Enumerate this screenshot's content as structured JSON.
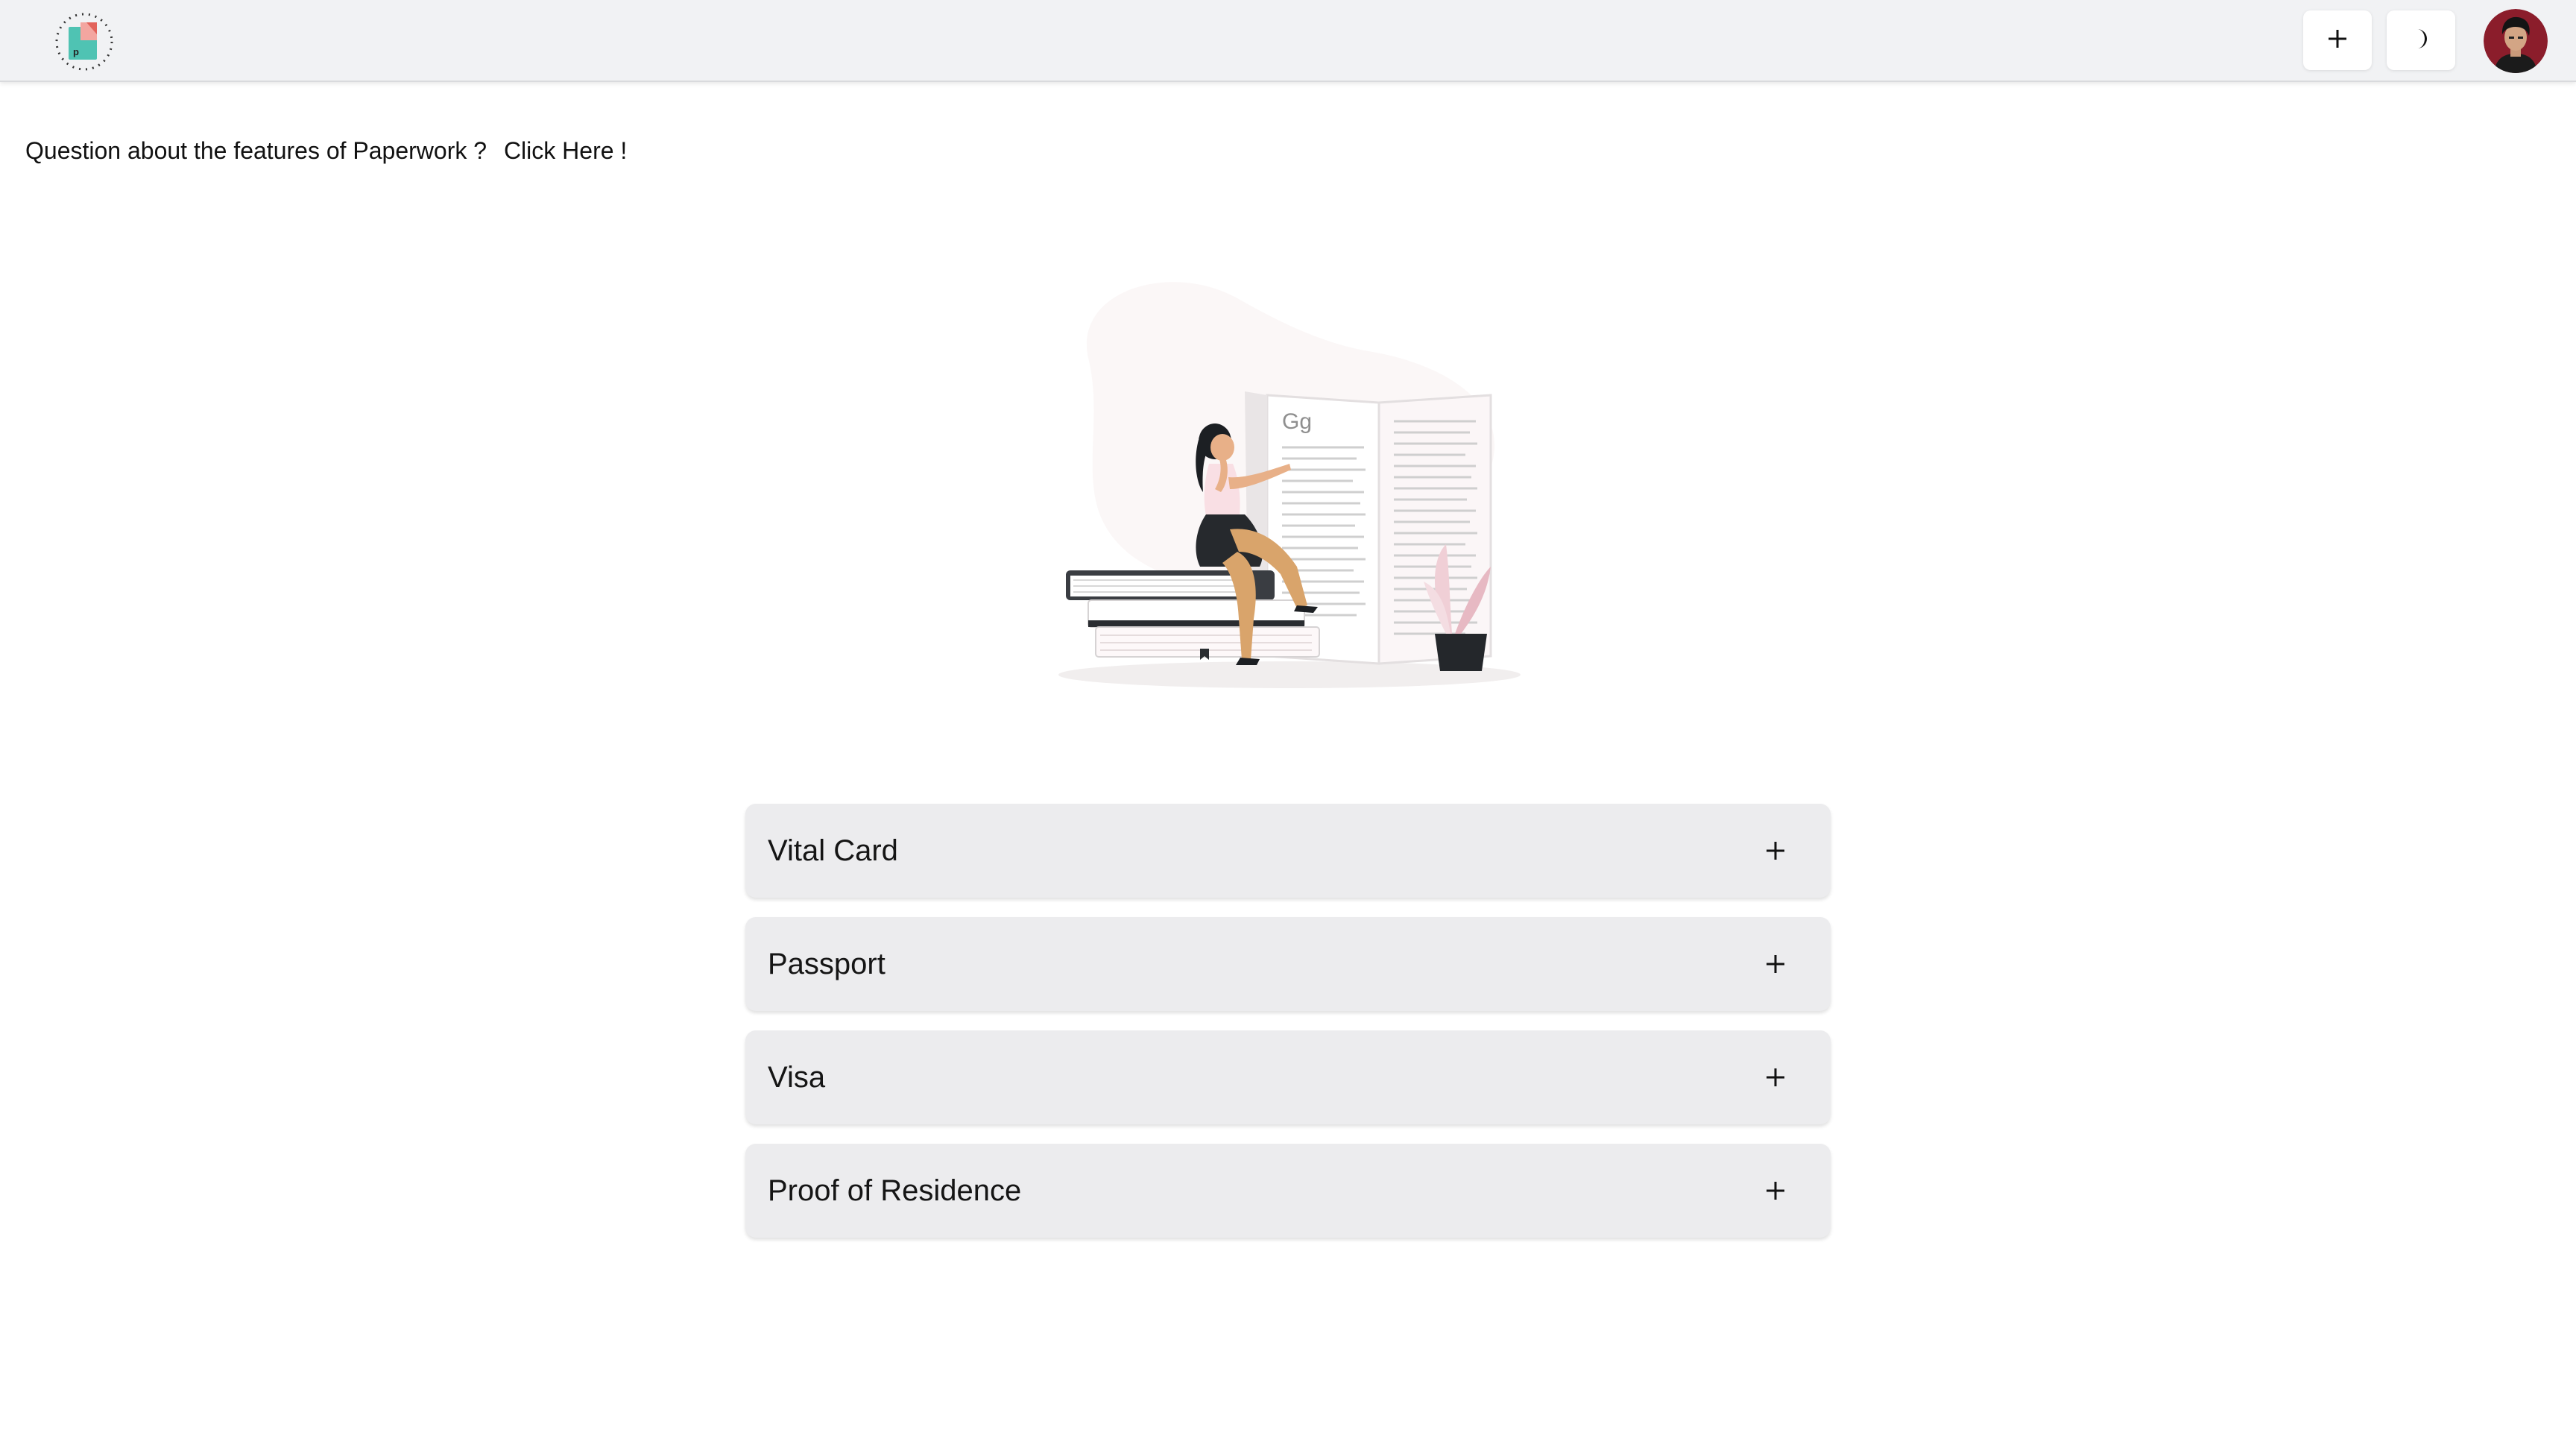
{
  "header": {
    "logo_icon": "paperwork-logo-icon",
    "add_icon": "plus-icon",
    "theme_icon": "moon-icon",
    "avatar_icon": "user-avatar"
  },
  "help": {
    "question": "Question about the features of Paperwork ?",
    "link": "Click Here !"
  },
  "illustration": {
    "icon": "woman-reading-books-illustration",
    "book_text": "Gg"
  },
  "documents": {
    "items": [
      {
        "label": "Vital Card"
      },
      {
        "label": "Passport"
      },
      {
        "label": "Visa"
      },
      {
        "label": "Proof of Residence"
      }
    ]
  },
  "colors": {
    "topbar": "#f1f2f4",
    "accordion": "#ececee",
    "avatar_bg": "#8b1d2b",
    "logo_teal": "#4fc3b3",
    "logo_red": "#e2625a"
  }
}
